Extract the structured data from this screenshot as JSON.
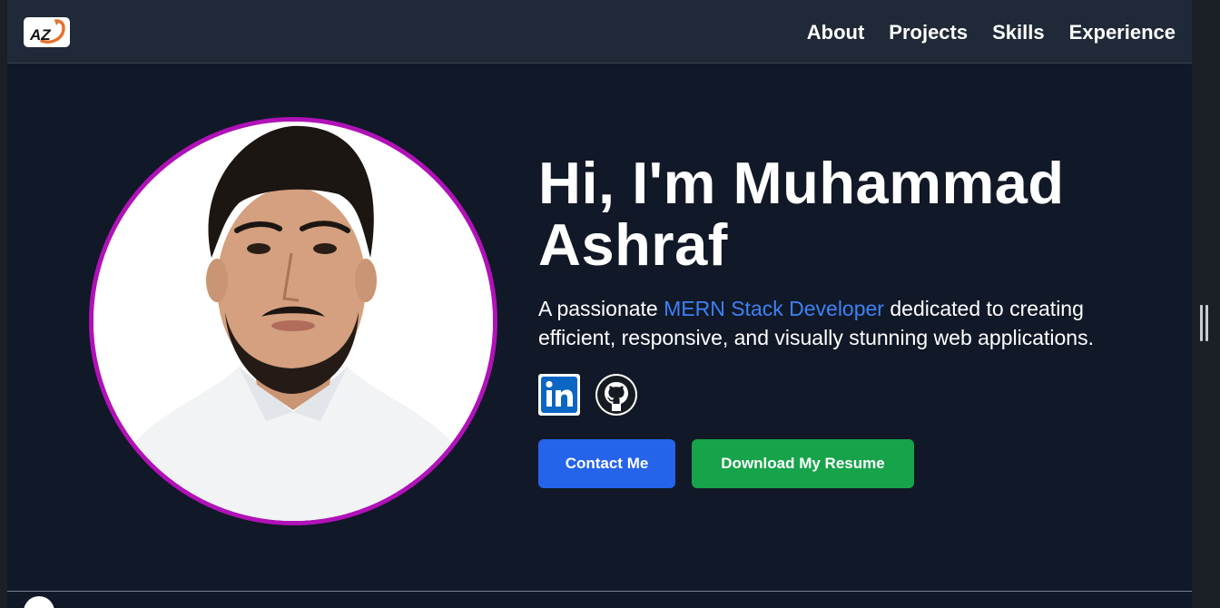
{
  "navbar": {
    "logo_text": "AZ",
    "links": [
      {
        "label": "About"
      },
      {
        "label": "Projects"
      },
      {
        "label": "Skills"
      },
      {
        "label": "Experience"
      }
    ]
  },
  "hero": {
    "title_line1": "Hi, I'm Muhammad",
    "title_line2": "Ashraf",
    "desc_before": "A passionate ",
    "desc_accent": "MERN Stack Developer",
    "desc_after": " dedicated to creating efficient, responsive, and visually stunning web applications.",
    "socials": [
      {
        "icon": "linkedin-icon"
      },
      {
        "icon": "github-icon"
      }
    ],
    "contact_label": "Contact Me",
    "resume_label": "Download My Resume"
  },
  "colors": {
    "background": "#111827",
    "navbar": "#1f2937",
    "accent": "#3b82f6",
    "contact_button": "#2563eb",
    "resume_button": "#16a34a",
    "photo_ring": "#b012b8"
  }
}
